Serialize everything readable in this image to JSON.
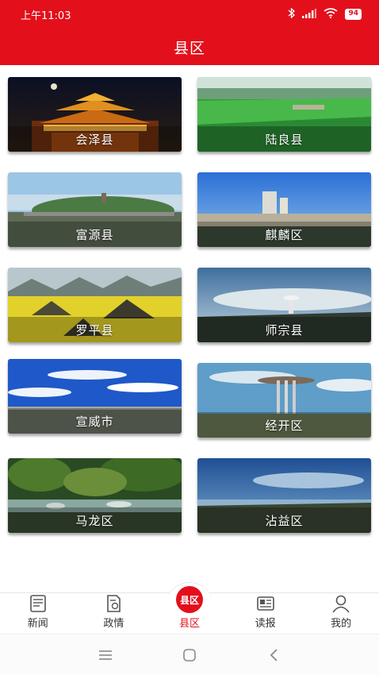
{
  "status_bar": {
    "time": "上午11:03",
    "battery": "94",
    "icons": [
      "bluetooth-icon",
      "signal-icon",
      "wifi-icon",
      "battery-icon"
    ]
  },
  "header": {
    "title": "县区"
  },
  "counties": [
    {
      "name": "会泽县"
    },
    {
      "name": "陆良县"
    },
    {
      "name": "富源县"
    },
    {
      "name": "麒麟区"
    },
    {
      "name": "罗平县"
    },
    {
      "name": "师宗县"
    },
    {
      "name": "宣威市"
    },
    {
      "name": "经开区"
    },
    {
      "name": "马龙区"
    },
    {
      "name": "沾益区"
    }
  ],
  "tabs": [
    {
      "label": "新闻",
      "icon": "newspaper-icon",
      "active": false
    },
    {
      "label": "政情",
      "icon": "document-icon",
      "active": false
    },
    {
      "label": "县区",
      "icon": "county-logo-icon",
      "active": true,
      "badge_text": "县区"
    },
    {
      "label": "读报",
      "icon": "reader-icon",
      "active": false
    },
    {
      "label": "我的",
      "icon": "person-icon",
      "active": false
    }
  ],
  "colors": {
    "brand": "#e3101c",
    "tab_text": "#333333"
  }
}
